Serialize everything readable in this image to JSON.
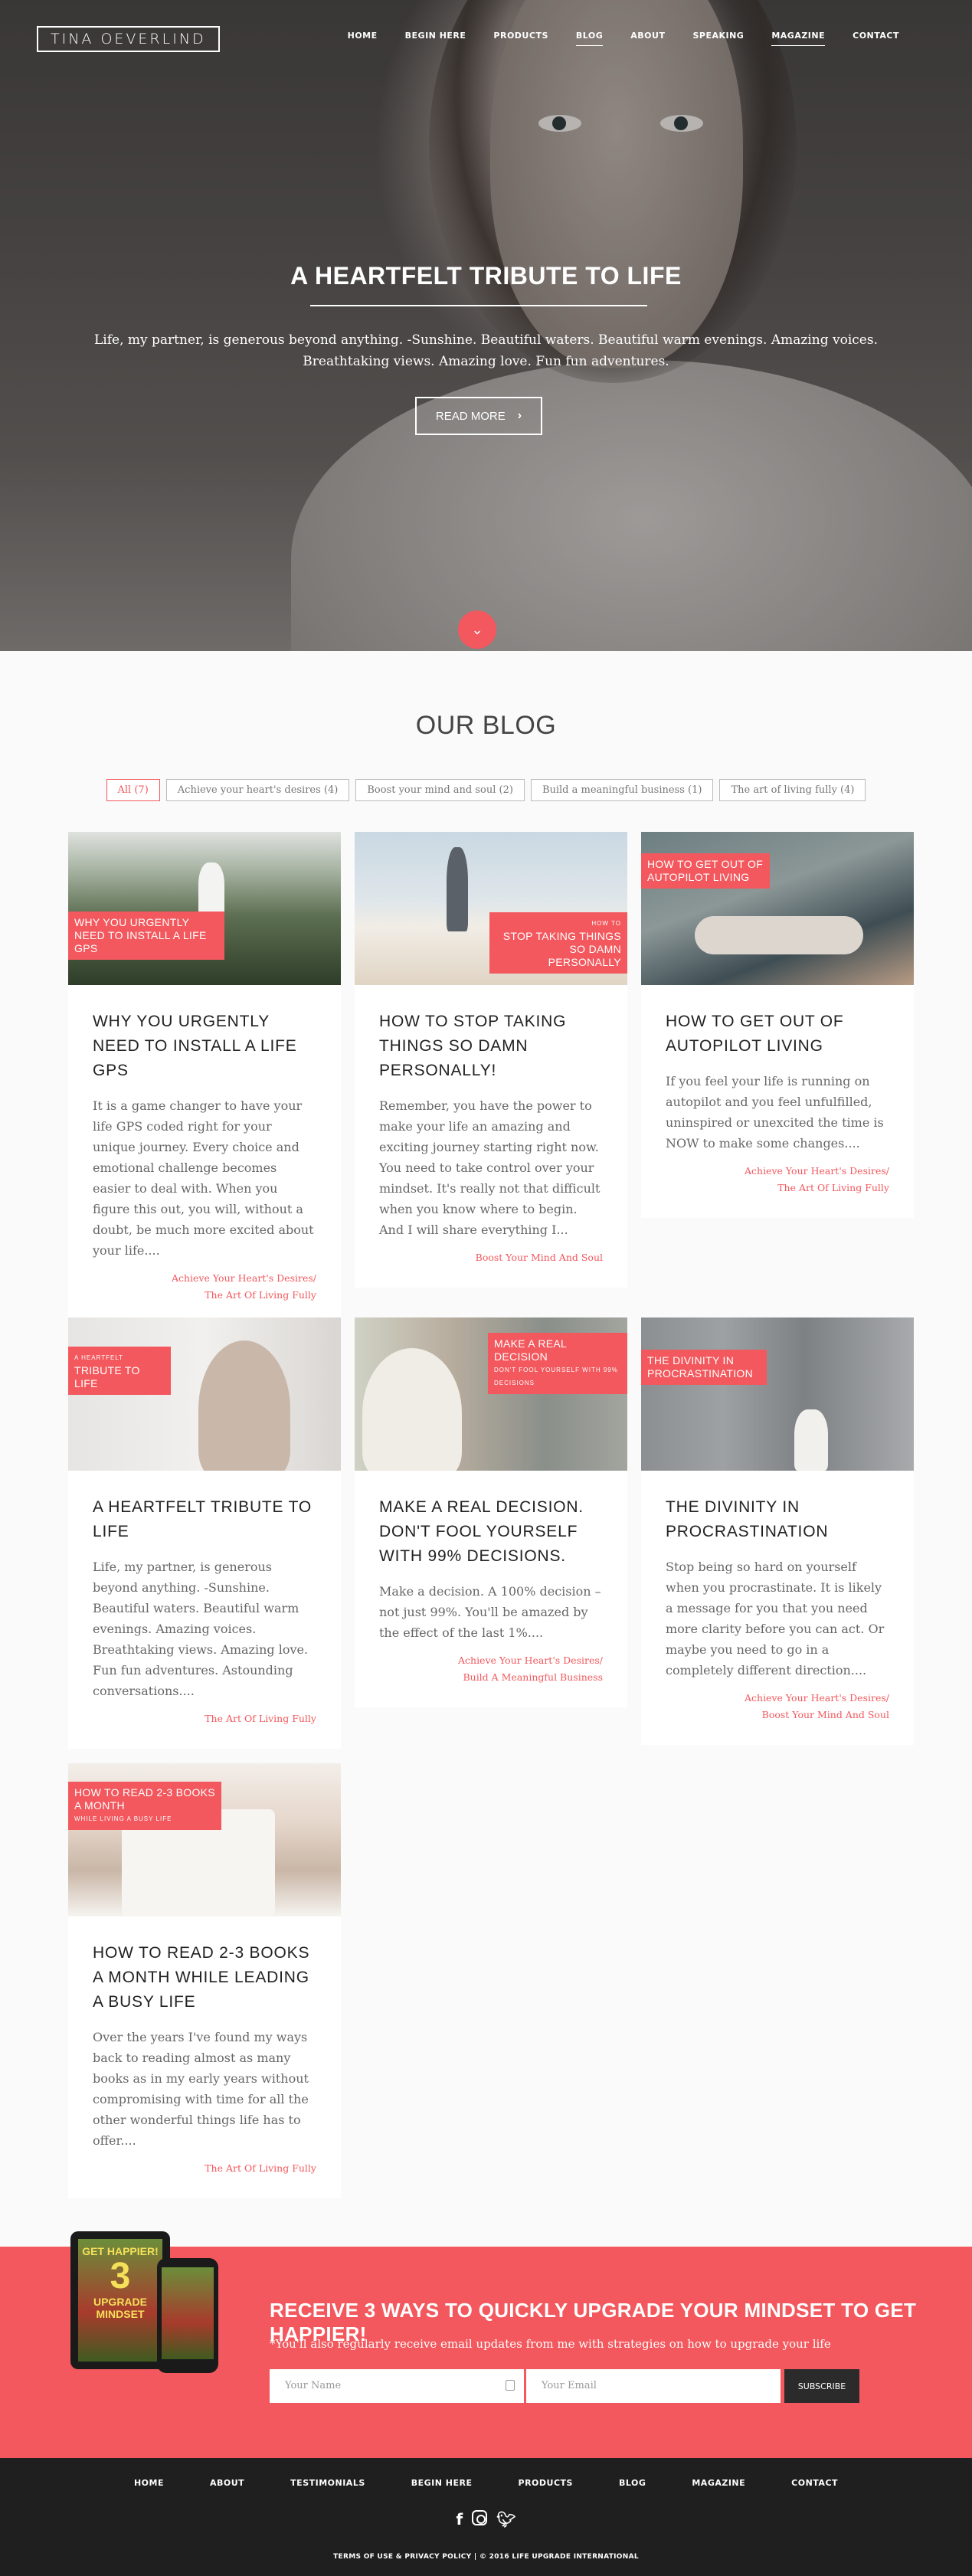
{
  "header": {
    "logo": "TINA OEVERLIND",
    "nav": [
      "HOME",
      "BEGIN HERE",
      "PRODUCTS",
      "BLOG",
      "ABOUT",
      "SPEAKING",
      "MAGAZINE",
      "CONTACT"
    ]
  },
  "hero": {
    "title": "A HEARTFELT TRIBUTE TO LIFE",
    "text": "Life, my partner, is generous beyond anything. -Sunshine. Beautiful waters. Beautiful warm evenings. Amazing voices. Breathtaking views. Amazing love. Fun fun adventures.",
    "button": "READ MORE",
    "button_icon": "chevron-right-icon",
    "scroll_icon": "chevron-down-icon"
  },
  "blog": {
    "title": "OUR BLOG",
    "filters": [
      "All (7)",
      "Achieve your heart's desires (4)",
      "Boost your mind and soul (2)",
      "Build a meaningful business (1)",
      "The art of living fully (4)"
    ],
    "posts": [
      {
        "ribbon": "WHY YOU URGENTLY NEED TO INSTALL A LIFE GPS",
        "title": "WHY YOU URGENTLY NEED TO INSTALL A LIFE GPS",
        "excerpt": "It is a game changer to have your life GPS coded right for your unique journey. Every choice and emotional challenge becomes easier to deal with. When you figure this out, you will, without a doubt, be much more excited about your life....",
        "cat1": "Achieve Your Heart's Desires/",
        "cat2": "The Art Of Living Fully"
      },
      {
        "ribbon_small": "HOW TO",
        "ribbon": "STOP TAKING THINGS SO DAMN PERSONALLY",
        "title": "HOW TO STOP TAKING THINGS SO DAMN PERSONALLY!",
        "excerpt": "Remember, you have the power to make your life an amazing and exciting journey starting right now. You need to take control over your mindset. It's really not that difficult when you know where to begin. And I will share everything I...",
        "cat1": "Boost Your Mind And Soul",
        "cat2": ""
      },
      {
        "ribbon": "HOW TO GET OUT OF AUTOPILOT LIVING",
        "title": "HOW TO GET OUT OF AUTOPILOT LIVING",
        "excerpt": "If you feel your life is running on autopilot and you feel unfulfilled, uninspired or unexcited the time is NOW to make some changes....",
        "cat1": "Achieve Your Heart's Desires/",
        "cat2": "The Art Of Living Fully"
      },
      {
        "ribbon_small": "A HEARTFELT",
        "ribbon": "TRIBUTE TO LIFE",
        "title": "A HEARTFELT TRIBUTE TO LIFE",
        "excerpt": "Life, my partner, is generous beyond anything. -Sunshine. Beautiful waters. Beautiful warm evenings. Amazing voices. Breathtaking views. Amazing love. Fun fun adventures. Astounding conversations....",
        "cat1": "The Art Of Living Fully",
        "cat2": ""
      },
      {
        "ribbon": "MAKE A REAL DECISION",
        "ribbon_small": "DON'T FOOL YOURSELF WITH 99% DECISIONS",
        "title": "MAKE A REAL DECISION. DON'T FOOL YOURSELF WITH 99% DECISIONS.",
        "excerpt": "Make a decision. A 100% decision – not just 99%. You'll be amazed by the effect of the last 1%....",
        "cat1": "Achieve Your Heart's Desires/",
        "cat2": "Build A Meaningful Business"
      },
      {
        "ribbon": "THE DIVINITY IN PROCRASTINATION",
        "title": "THE DIVINITY IN PROCRASTINATION",
        "excerpt": "Stop being so hard on yourself when you procrastinate. It is likely a message for you that you need more clarity before you can act. Or maybe you need to go in a completely different direction....",
        "cat1": "Achieve Your Heart's Desires/",
        "cat2": "Boost Your Mind And Soul"
      },
      {
        "ribbon": "HOW TO READ 2-3 BOOKS A MONTH",
        "ribbon_small": "WHILE LIVING A BUSY LIFE",
        "title": "HOW TO READ 2-3 BOOKS A MONTH WHILE LEADING A BUSY LIFE",
        "excerpt": "Over the years I've found my ways back to reading almost as many books as in my early years without compromising with time for all the other wonderful things life has to offer....",
        "cat1": "The Art Of Living Fully",
        "cat2": ""
      }
    ]
  },
  "subscribe": {
    "product_line1": "GET HAPPIER!",
    "product_line2": "3",
    "product_line3": "UPGRADE",
    "product_line4": "MINDSET",
    "title": "RECEIVE 3 WAYS TO QUICKLY UPGRADE YOUR MINDSET TO GET HAPPIER!",
    "note": "*You'll also regularly receive email updates from me with strategies on how to upgrade your life",
    "name_placeholder": "Your Name",
    "email_placeholder": "Your Email",
    "button": "SUBSCRIBE",
    "accent": "#f2585d"
  },
  "footer": {
    "nav": [
      "HOME",
      "ABOUT",
      "TESTIMONIALS",
      "BEGIN HERE",
      "PRODUCTS",
      "BLOG",
      "MAGAZINE",
      "CONTACT"
    ],
    "social": [
      "facebook-icon",
      "instagram-icon",
      "twitter-icon"
    ],
    "copyright": "TERMS OF USE & PRIVACY POLICY | © 2016 LIFE UPGRADE INTERNATIONAL"
  }
}
